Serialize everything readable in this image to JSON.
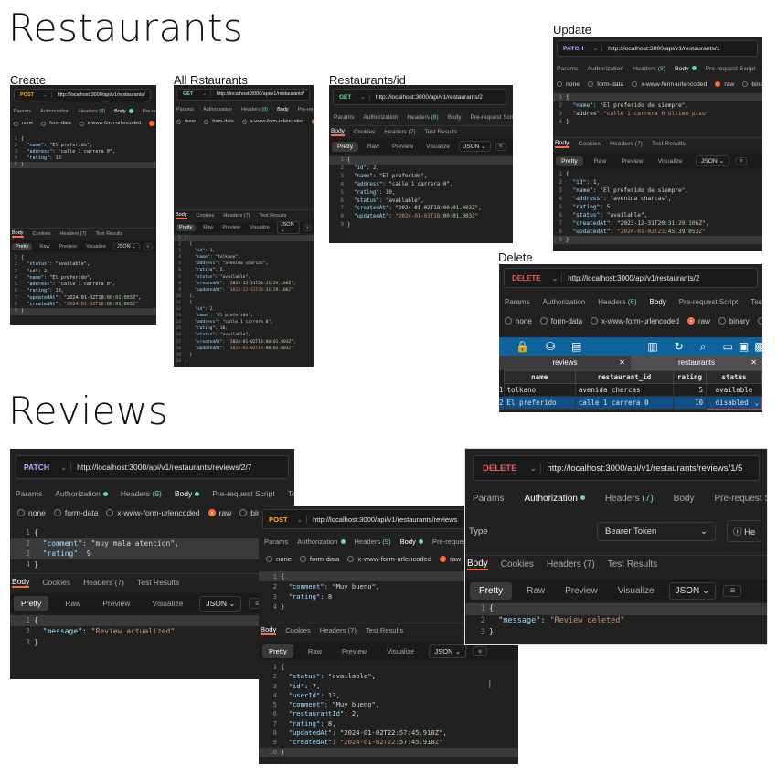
{
  "headings": {
    "restaurants": "Restaurants",
    "reviews": "Reviews"
  },
  "captions": {
    "create": "Create",
    "all": "All Rstaurants",
    "by_id": "Restaurants/id",
    "update": "Update",
    "delete": "Delete"
  },
  "tabs": {
    "params": "Params",
    "authorization": "Authorization",
    "headers": "Headers",
    "body": "Body",
    "prerequest": "Pre-request Script",
    "tests": "Tests"
  },
  "counts": {
    "h6": "(6)",
    "h8": "(8)",
    "h9": "(9)",
    "h7": "(7)"
  },
  "body_types": {
    "none": "none",
    "form_data": "form-data",
    "urlencoded": "x-www-form-urlencoded",
    "raw": "raw",
    "binary": "binary",
    "bin": "bin",
    "gr": "Gr"
  },
  "resp_tabs": {
    "body": "Body",
    "cookies": "Cookies",
    "headers7": "Headers (7)",
    "test_results": "Test Results"
  },
  "view": {
    "pretty": "Pretty",
    "raw": "Raw",
    "preview": "Preview",
    "visualize": "Visualize",
    "json": "JSON",
    "type": "Type",
    "bearer": "Bearer Token",
    "he": "He"
  },
  "methods": {
    "post": "POST",
    "get": "GET",
    "patch": "PATCH",
    "delete": "DELETE"
  },
  "urls": {
    "create": "http://localhost:3000/api/v1/restaurants/",
    "all": "http://localhost:3000/api/v1/restaurants/",
    "by_id": "http://localhost:3000/api/v1/restaurants/2",
    "update": "http://localhost:3000/api/v1/restaurants/1",
    "delete": "http://localhost:3000/api/v1/restaurants/2",
    "review_patch": "http://localhost:3000/api/v1/restaurants/reviews/2/7",
    "review_post": "http://localhost:3000/api/v1/restaurants/reviews",
    "review_delete": "http://localhost:3000/api/v1/restaurants/reviews/1/5"
  },
  "code": {
    "create_req": [
      "{",
      "  \"name\": \"El preferido\",",
      "  \"address\": \"calle 1 carrera 0\",",
      "  \"rating\": 10",
      "}"
    ],
    "create_res": [
      "{",
      "  \"status\": \"available\",",
      "  \"id\": 2,",
      "  \"name\": \"El preferido\",",
      "  \"address\": \"calle 1 carrera 0\",",
      "  \"rating\": 10,",
      "  \"updatedAt\": \"2024-01-02T18:00:01.003Z\",",
      "  \"createdAt\": \"2024-01-02T18:00:01.003Z\"",
      "}"
    ],
    "all_res": [
      "[",
      "  {",
      "    \"id\": 1,",
      "    \"name\": \"tolkano\",",
      "    \"address\": \"avenida charcas\",",
      "    \"rating\": 5,",
      "    \"status\": \"available\",",
      "    \"createdAt\": \"2023-12-31T20:31:29.106Z\",",
      "    \"updatedAt\": \"2023-12-31T20:31:29.106Z\"",
      "  },",
      "  {",
      "    \"id\": 2,",
      "    \"name\": \"El preferido\",",
      "    \"address\": \"calle 1 carrera 0\",",
      "    \"rating\": 10,",
      "    \"status\": \"available\",",
      "    \"createdAt\": \"2024-01-02T18:00:01.003Z\",",
      "    \"updatedAt\": \"2024-01-02T18:00:01.003Z\"",
      "  }",
      "]"
    ],
    "byid_res": [
      "{",
      "  \"id\": 2,",
      "  \"name\": \"El preferido\",",
      "  \"address\": \"calle 1 carrera 0\",",
      "  \"rating\": 10,",
      "  \"status\": \"available\",",
      "  \"createdAt\": \"2024-01-02T18:00:01.003Z\",",
      "  \"updatedAt\": \"2024-01-02T18:00:01.003Z\"",
      "}"
    ],
    "update_req": [
      "{",
      "  \"name\": \"El preferido de siempre\",",
      "  \"addres\" \"calle 1 carrera 0 último piso\"",
      "}"
    ],
    "update_res": [
      "{",
      "  \"id\": 1,",
      "  \"name\": \"El preferido de siempre\",",
      "  \"address\": \"avenida charcas\",",
      "  \"rating\": 5,",
      "  \"status\": \"available\",",
      "  \"createdAt\": \"2023-12-31T20:31:29.106Z\",",
      "  \"updatedAt\": \"2024-01-02T23:45:39.053Z\"",
      "}"
    ],
    "rpatch_req": [
      "{",
      "  \"comment\": \"muy mala atencion\",",
      "  \"rating\": 9",
      "}"
    ],
    "rpatch_res": [
      "{",
      "  \"message\": \"Review actualized\"",
      "}"
    ],
    "rpost_req": [
      "{",
      "  \"comment\": \"Muy bueno\",",
      "  \"rating\": 8",
      "}"
    ],
    "rpost_res": [
      "{",
      "  \"status\": \"available\",",
      "  \"id\": 7,",
      "  \"userId\": 13,",
      "  \"comment\": \"Muy bueno\",",
      "  \"restaurantId\": 2,",
      "  \"rating\": 8,",
      "  \"updatedAt\": \"2024-01-02T22:57:45.918Z\",",
      "  \"createdAt\": \"2024-01-02T22:57:45.918Z\"",
      "}"
    ],
    "rdelete_res": [
      "{",
      "  \"message\": \"Review deleted\"",
      "}"
    ]
  },
  "db": {
    "tab_reviews": "reviews",
    "tab_restaurants": "restaurants",
    "columns": [
      "name",
      "restaurant_id",
      "rating",
      "status"
    ],
    "rows": [
      {
        "num": "1",
        "name": "tolkano",
        "restaurant_id": "avenida charcas",
        "rating": "5",
        "status": "available"
      },
      {
        "num": "2",
        "name": "El preferido",
        "restaurant_id": "calle 1 carrera 0",
        "rating": "10",
        "status": "disabled"
      }
    ]
  }
}
